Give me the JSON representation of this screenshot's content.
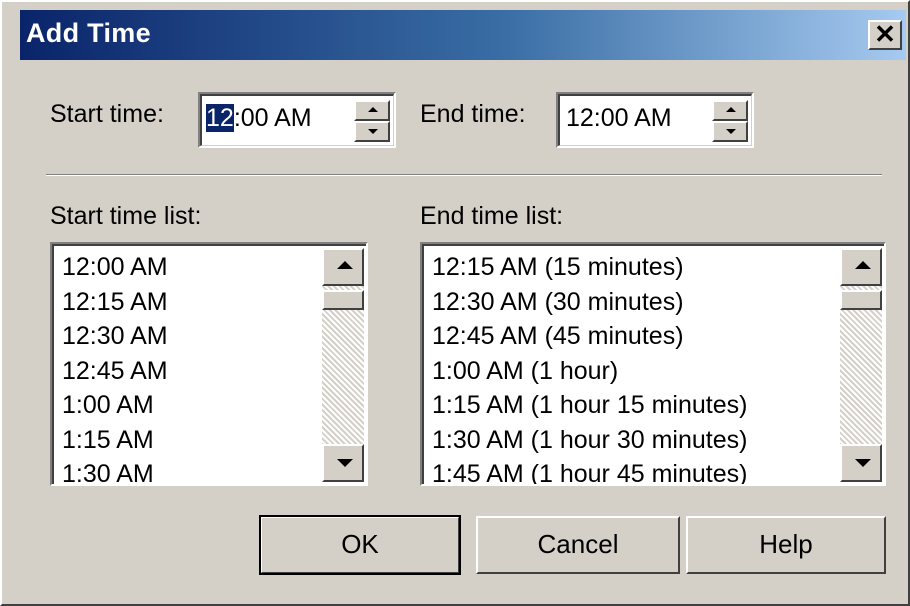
{
  "dialog": {
    "title": "Add Time",
    "close_glyph": "✕"
  },
  "start_time": {
    "label": "Start time:",
    "value_selected": "12",
    "value_rest": ":00 AM"
  },
  "end_time": {
    "label": "End time:",
    "value": "12:00 AM"
  },
  "start_list": {
    "label": "Start time list:",
    "items": [
      "12:00 AM",
      "12:15 AM",
      "12:30 AM",
      "12:45 AM",
      "1:00 AM",
      "1:15 AM",
      "1:30 AM"
    ]
  },
  "end_list": {
    "label": "End time list:",
    "items": [
      "12:15 AM (15 minutes)",
      "12:30 AM (30 minutes)",
      "12:45 AM (45 minutes)",
      "1:00 AM (1 hour)",
      "1:15 AM (1 hour 15 minutes)",
      "1:30 AM (1 hour 30 minutes)",
      "1:45 AM (1 hour 45 minutes)"
    ]
  },
  "buttons": {
    "ok": "OK",
    "cancel": "Cancel",
    "help": "Help"
  },
  "icons": {
    "spin_up": "chevron-up-icon",
    "spin_down": "chevron-down-icon",
    "scroll_up": "scroll-up-arrow-icon",
    "scroll_down": "scroll-down-arrow-icon",
    "close": "close-icon"
  },
  "colors": {
    "title_gradient_start": "#0a246a",
    "title_gradient_end": "#a6caf0",
    "face": "#d4d0c8",
    "selection": "#0a246a"
  }
}
